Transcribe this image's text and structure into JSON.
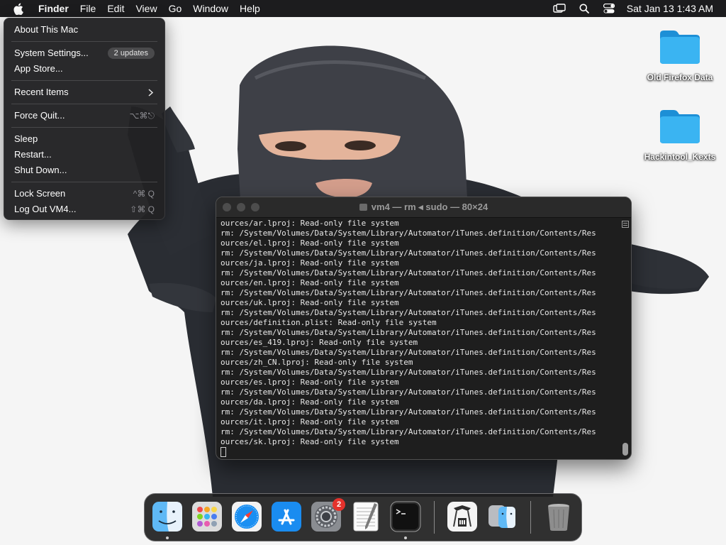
{
  "menubar": {
    "app_name": "Finder",
    "items": [
      "File",
      "Edit",
      "View",
      "Go",
      "Window",
      "Help"
    ],
    "clock": "Sat Jan 13  1:43 AM"
  },
  "apple_menu": {
    "about": "About This Mac",
    "system_settings": "System Settings...",
    "updates_badge": "2 updates",
    "app_store": "App Store...",
    "recent_items": "Recent Items",
    "force_quit": "Force Quit...",
    "force_quit_shortcut": "⌥⌘⎋",
    "sleep": "Sleep",
    "restart": "Restart...",
    "shut_down": "Shut Down...",
    "lock_screen": "Lock Screen",
    "lock_screen_shortcut": "^⌘ Q",
    "log_out": "Log Out VM4...",
    "log_out_shortcut": "⇧⌘ Q"
  },
  "desktop": {
    "icons": [
      "Old Firefox Data",
      "Hackintool_Kexts"
    ],
    "folder_color": "#2aa6e8"
  },
  "terminal": {
    "title": "vm4 — rm ◂ sudo — 80×24",
    "lines": [
      "ources/ar.lproj: Read-only file system",
      "rm: /System/Volumes/Data/System/Library/Automator/iTunes.definition/Contents/Res",
      "ources/el.lproj: Read-only file system",
      "rm: /System/Volumes/Data/System/Library/Automator/iTunes.definition/Contents/Res",
      "ources/ja.lproj: Read-only file system",
      "rm: /System/Volumes/Data/System/Library/Automator/iTunes.definition/Contents/Res",
      "ources/en.lproj: Read-only file system",
      "rm: /System/Volumes/Data/System/Library/Automator/iTunes.definition/Contents/Res",
      "ources/uk.lproj: Read-only file system",
      "rm: /System/Volumes/Data/System/Library/Automator/iTunes.definition/Contents/Res",
      "ources/definition.plist: Read-only file system",
      "rm: /System/Volumes/Data/System/Library/Automator/iTunes.definition/Contents/Res",
      "ources/es_419.lproj: Read-only file system",
      "rm: /System/Volumes/Data/System/Library/Automator/iTunes.definition/Contents/Res",
      "ources/zh_CN.lproj: Read-only file system",
      "rm: /System/Volumes/Data/System/Library/Automator/iTunes.definition/Contents/Res",
      "ources/es.lproj: Read-only file system",
      "rm: /System/Volumes/Data/System/Library/Automator/iTunes.definition/Contents/Res",
      "ources/da.lproj: Read-only file system",
      "rm: /System/Volumes/Data/System/Library/Automator/iTunes.definition/Contents/Res",
      "ources/it.lproj: Read-only file system",
      "rm: /System/Volumes/Data/System/Library/Automator/iTunes.definition/Contents/Res",
      "ources/sk.lproj: Read-only file system"
    ]
  },
  "dock": {
    "apps": [
      "Finder",
      "Launchpad",
      "Safari",
      "App Store",
      "System Settings",
      "TextEdit",
      "Terminal",
      "Hackintool",
      "Migration Assistant",
      "Trash"
    ],
    "settings_badge": "2"
  }
}
